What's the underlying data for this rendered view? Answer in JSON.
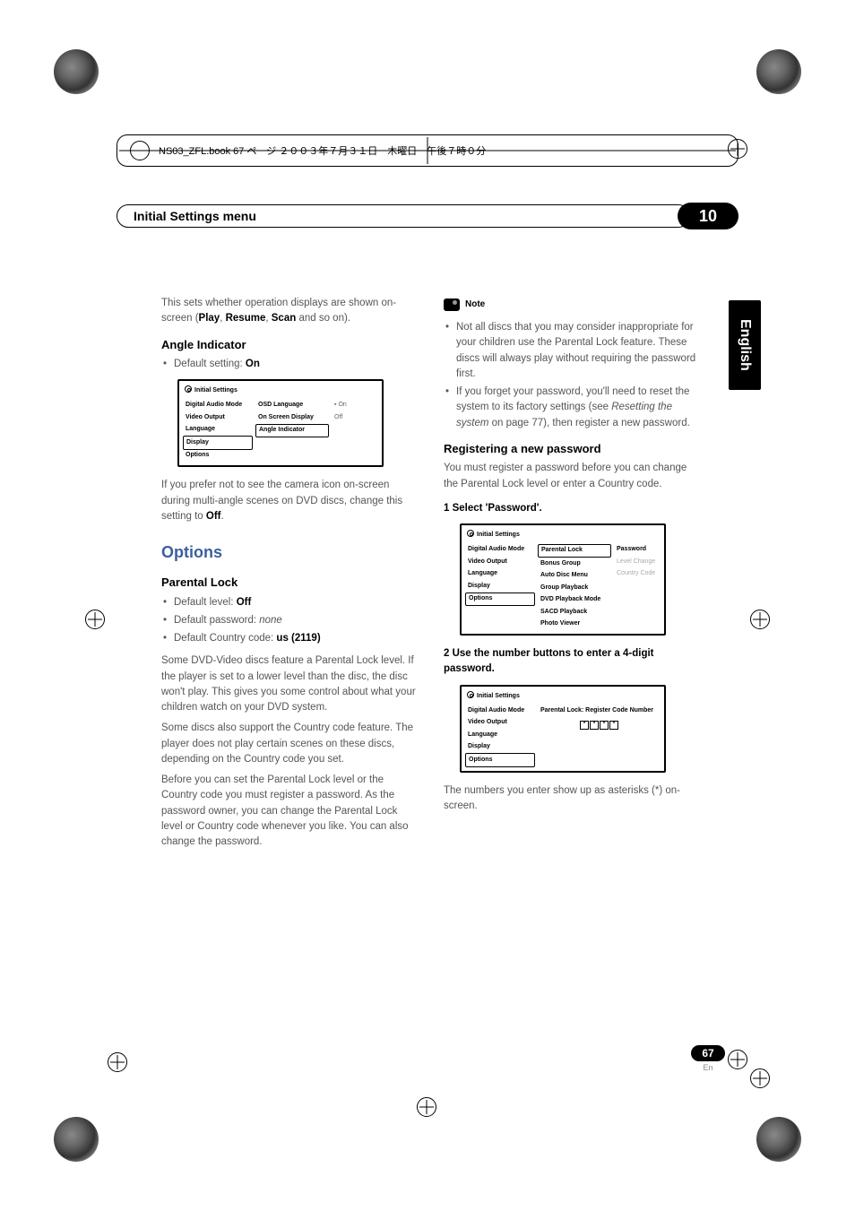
{
  "header": {
    "jp_text": "NS03_ZFL.book  67 ページ  ２００３年７月３１日　木曜日　午後７時０分"
  },
  "title_bar": "Initial Settings menu",
  "chapter": "10",
  "side_tab": "English",
  "left": {
    "intro": "This sets whether operation displays are shown on-screen (",
    "intro_b1": "Play",
    "intro_sep1": ", ",
    "intro_b2": "Resume",
    "intro_sep2": ", ",
    "intro_b3": "Scan",
    "intro_end": " and so on).",
    "angle_h": "Angle Indicator",
    "angle_bullet_pre": "Default setting: ",
    "angle_bullet_b": "On",
    "menu1": {
      "title": "Initial Settings",
      "col1": [
        "Digital Audio Mode",
        "Video Output",
        "Language",
        "Display",
        "Options"
      ],
      "col2": [
        "OSD Language",
        "On Screen Display",
        "Angle Indicator"
      ],
      "col3": [
        "On",
        "Off"
      ]
    },
    "angle_body_pre": "If you prefer not to see the camera icon on-screen during multi-angle scenes on DVD discs, change this setting to ",
    "angle_body_b": "Off",
    "angle_body_end": ".",
    "options_h": "Options",
    "parental_h": "Parental Lock",
    "pl_b1_pre": "Default level: ",
    "pl_b1_b": "Off",
    "pl_b2_pre": "Default password: ",
    "pl_b2_i": "none",
    "pl_b3_pre": "Default Country code: ",
    "pl_b3_b": "us (2119)",
    "pl_p1": "Some DVD-Video discs feature a Parental Lock level. If the player is set to a lower level than the disc, the disc won't play. This gives you some control about what your children watch on your DVD system.",
    "pl_p2": "Some discs also support the Country code feature. The player does not play certain scenes on these discs, depending on the Country code you set.",
    "pl_p3": "Before you can set the Parental Lock level or the Country code you must register a password. As the password owner, you can change the Parental Lock level or Country code whenever you like. You can also change the password."
  },
  "right": {
    "note_label": "Note",
    "note1": "Not all discs that you may consider inappropriate for your children use the Parental Lock feature. These discs will always play without requiring the password first.",
    "note2_pre": "If you forget your password, you'll need to reset the system to its factory settings (see ",
    "note2_i": "Resetting the system",
    "note2_mid": " on page 77), then register a new password.",
    "reg_h": "Registering a new password",
    "reg_p": "You must register a password before you can change the Parental Lock level or enter a Country code.",
    "step1": "1    Select 'Password'.",
    "menu2": {
      "title": "Initial Settings",
      "col1": [
        "Digital Audio Mode",
        "Video Output",
        "Language",
        "Display",
        "Options"
      ],
      "col2": [
        "Parental Lock",
        "Bonus Group",
        "Auto Disc Menu",
        "Group Playback",
        "DVD Playback Mode",
        "SACD Playback",
        "Photo Viewer"
      ],
      "col3": [
        "Password",
        "Level Change",
        "Country Code"
      ]
    },
    "step2": "2    Use the number buttons to enter a 4-digit password.",
    "menu3": {
      "title": "Initial Settings",
      "col1": [
        "Digital Audio Mode",
        "Video Output",
        "Language",
        "Display",
        "Options"
      ],
      "label": "Parental Lock: Register Code Number"
    },
    "last_p": "The numbers you enter show up as asterisks (*) on-screen."
  },
  "page": {
    "num": "67",
    "en": "En"
  }
}
